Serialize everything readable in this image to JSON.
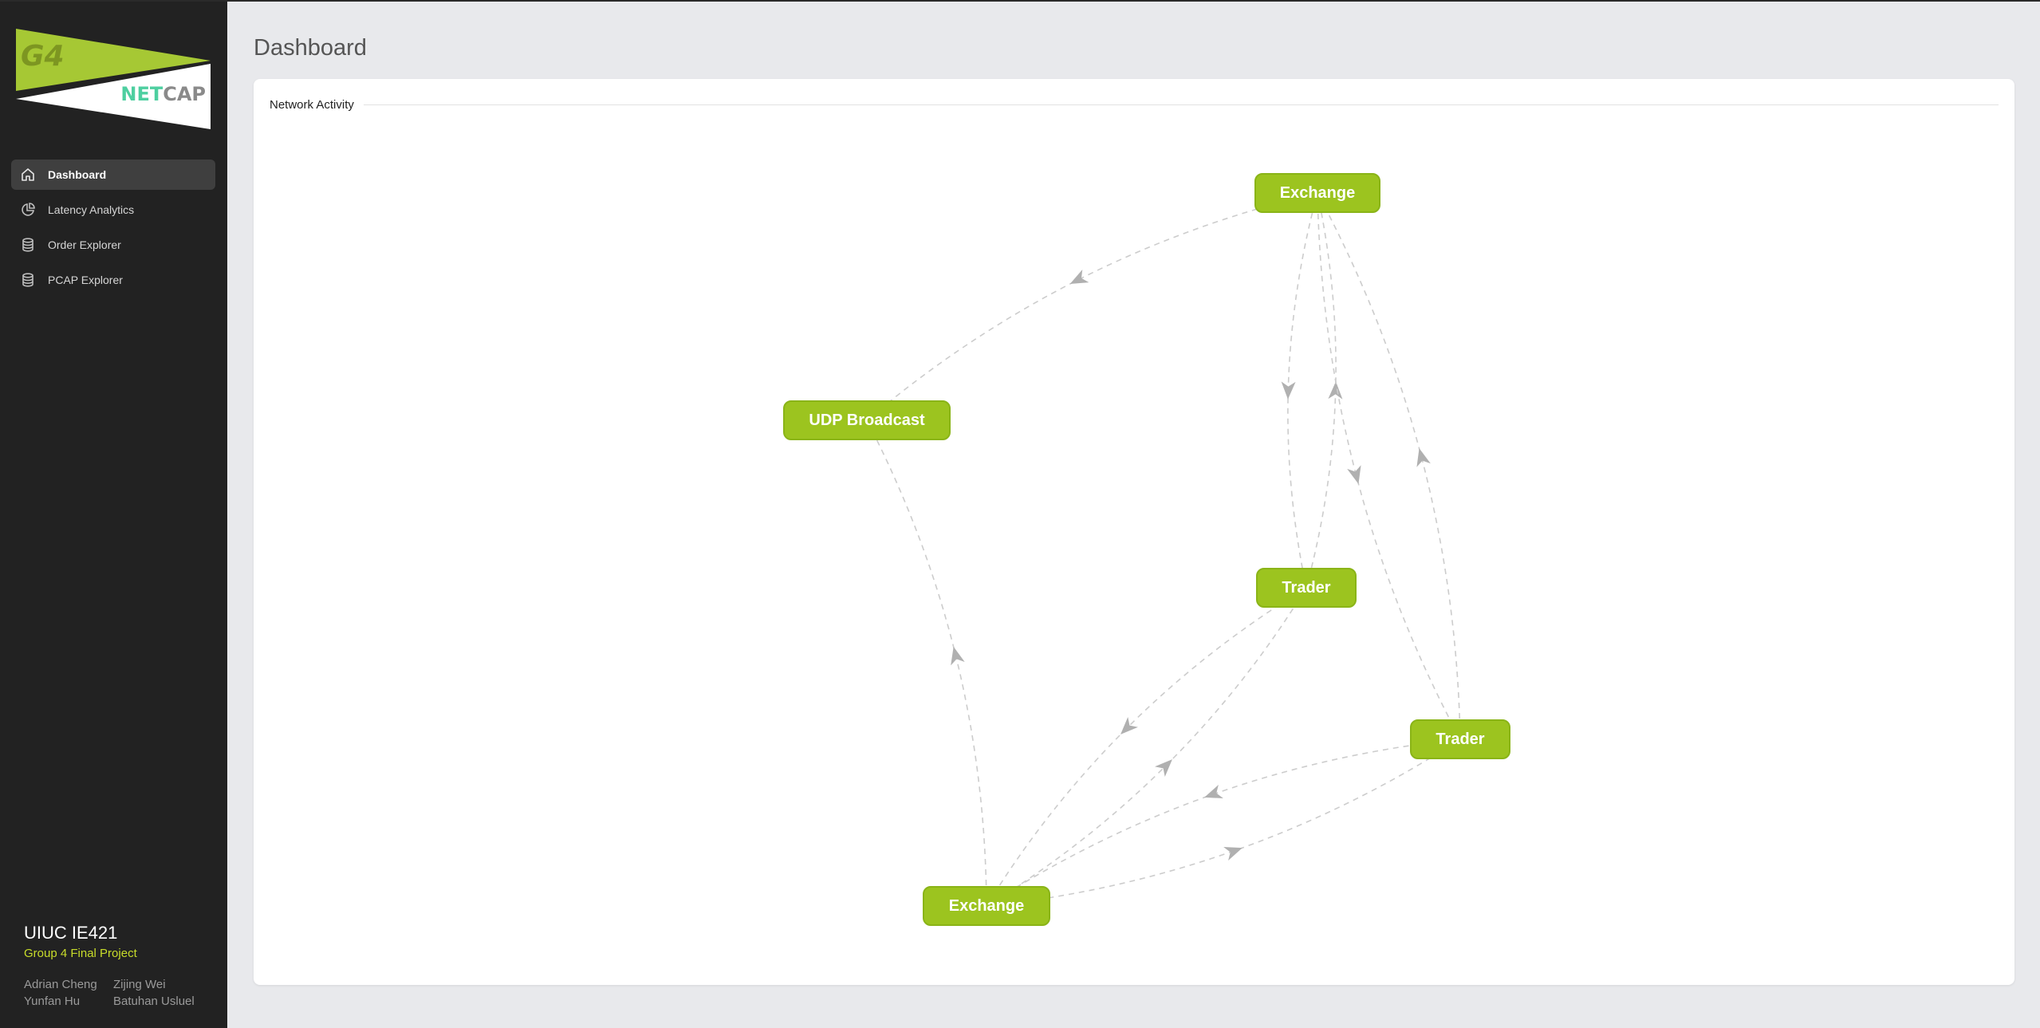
{
  "brand": {
    "logo_text_left": "G4",
    "logo_text_net": "NET",
    "logo_text_cap": "CAP",
    "primary_color": "#9cc41f",
    "accent_color": "#c8dc2a",
    "net_color": "#4ecfa0"
  },
  "sidebar": {
    "items": [
      {
        "label": "Dashboard",
        "icon": "home-icon",
        "active": true
      },
      {
        "label": "Latency Analytics",
        "icon": "pie-chart-icon",
        "active": false
      },
      {
        "label": "Order Explorer",
        "icon": "database-icon",
        "active": false
      },
      {
        "label": "PCAP Explorer",
        "icon": "database-icon",
        "active": false
      }
    ]
  },
  "footer": {
    "course": "UIUC IE421",
    "project": "Group 4 Final Project",
    "members": [
      "Adrian Cheng",
      "Zijing Wei",
      "Yunfan Hu",
      "Batuhan Usluel"
    ]
  },
  "page": {
    "title": "Dashboard"
  },
  "panel": {
    "title": "Network Activity",
    "nodes": [
      {
        "id": "exchange-top",
        "label": "Exchange"
      },
      {
        "id": "udp-broadcast",
        "label": "UDP Broadcast"
      },
      {
        "id": "trader-middle",
        "label": "Trader"
      },
      {
        "id": "trader-right",
        "label": "Trader"
      },
      {
        "id": "exchange-bottom",
        "label": "Exchange"
      }
    ],
    "edges": [
      {
        "from": "exchange-top",
        "to": "udp-broadcast"
      },
      {
        "from": "exchange-bottom",
        "to": "udp-broadcast"
      },
      {
        "from": "trader-middle",
        "to": "exchange-top"
      },
      {
        "from": "exchange-top",
        "to": "trader-middle"
      },
      {
        "from": "exchange-top",
        "to": "trader-right"
      },
      {
        "from": "trader-right",
        "to": "exchange-top"
      },
      {
        "from": "exchange-bottom",
        "to": "trader-middle"
      },
      {
        "from": "trader-middle",
        "to": "exchange-bottom"
      },
      {
        "from": "exchange-bottom",
        "to": "trader-right"
      },
      {
        "from": "trader-right",
        "to": "exchange-bottom"
      }
    ],
    "edge_color": "#cccccc",
    "arrow_color": "#b0b0b0"
  }
}
